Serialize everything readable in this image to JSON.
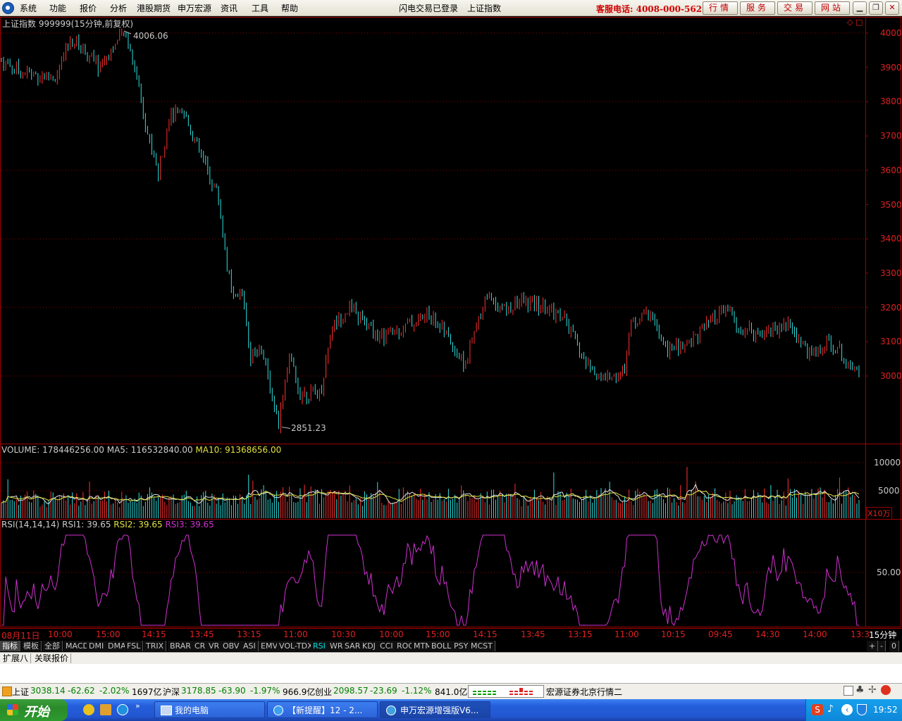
{
  "menubar": {
    "items": [
      "系统",
      "功能",
      "报价",
      "分析",
      "港股期货",
      "申万宏源",
      "资讯",
      "工具",
      "帮助"
    ],
    "login_status": "闪电交易已登录",
    "title": "上证指数",
    "hotline": "客服电话: 4008-000-562",
    "buttons": [
      "行情",
      "服务",
      "交易",
      "网站"
    ]
  },
  "chart": {
    "title": "上证指数 999999(15分钟,前复权)",
    "high_label": "4006.06",
    "low_label": "2851.23",
    "price_axis": [
      "4000",
      "3900",
      "3800",
      "3700",
      "3600",
      "3500",
      "3400",
      "3300",
      "3200",
      "3100",
      "3000"
    ],
    "volume_header": {
      "volume": "VOLUME: 178446256.00",
      "ma5": "MA5: 116532840.00",
      "ma10": "MA10: 91368656.00"
    },
    "volume_axis": [
      "10000",
      "5000"
    ],
    "volume_unit": "X10万",
    "rsi_header": {
      "label": "RSI(14,14,14)",
      "rsi1": "RSI1: 39.65",
      "rsi2": "RSI2: 39.65",
      "rsi3": "RSI3: 39.65"
    },
    "rsi_axis": [
      "50.00"
    ],
    "time_axis": [
      "08月11日",
      "10:00",
      "15:00",
      "14:15",
      "13:45",
      "13:15",
      "11:00",
      "10:30",
      "10:00",
      "15:00",
      "14:15",
      "13:45",
      "13:15",
      "11:00",
      "10:15",
      "09:45",
      "14:30",
      "14:00",
      "13:3"
    ],
    "period": "15分钟",
    "colors": {
      "up": "#ff3030",
      "down": "#30e0e0",
      "ma10": "#e0e040",
      "rsi": "#d030d0",
      "grid": "#8b0000"
    }
  },
  "indicator_tabs": [
    "指标",
    "模板",
    "全部",
    "MACD",
    "DMI",
    "DMA",
    "FSL",
    "TRIX",
    "BRAR",
    "CR",
    "VR",
    "OBV",
    "ASI",
    "EMV",
    "VOL-TDX",
    "RSI",
    "WR",
    "SAR",
    "KDJ",
    "CCI",
    "ROC",
    "MTM",
    "BOLL",
    "PSY",
    "MCST"
  ],
  "tab_controls": [
    "+",
    "-",
    "0"
  ],
  "ext_tabs": [
    "扩展八",
    "关联报价"
  ],
  "statusbar": {
    "sh_name": "上证",
    "sh_price": "3038.14",
    "sh_change": "-62.62",
    "sh_pct": "-2.02%",
    "sh_amount": "1697亿",
    "hs_name": "沪深",
    "hs_price": "3178.85",
    "hs_change": "-63.90",
    "hs_pct": "-1.97%",
    "hs_amount": "966.9亿",
    "cy_name": "创业",
    "cy_price": "2098.57",
    "cy_change": "-23.69",
    "cy_pct": "-1.12%",
    "cy_amount": "841.0亿",
    "broker": "宏源证券北京行情二"
  },
  "taskbar": {
    "start": "开始",
    "tasks": [
      "我的电脑",
      "【新提醒】12 - 2...",
      "申万宏源增强版V6..."
    ],
    "clock": "19:52"
  }
}
